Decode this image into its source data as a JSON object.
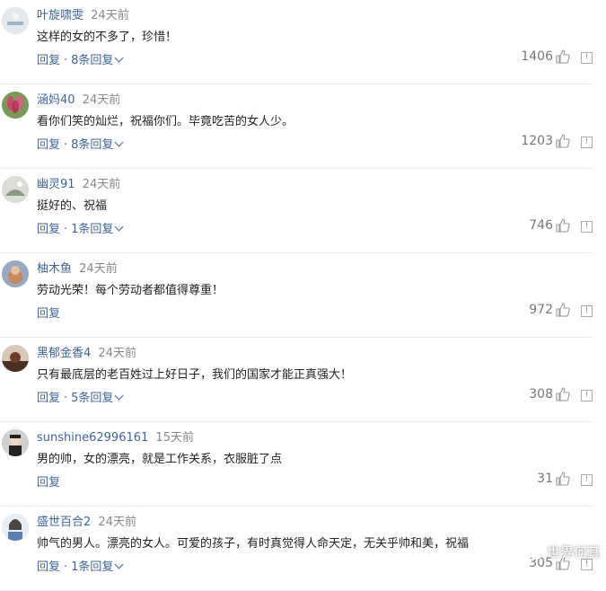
{
  "actions": {
    "reply_label": "回复"
  },
  "comments": [
    {
      "author": "叶旋啸雯",
      "time": "24天前",
      "text": "这样的女的不多了，珍惜！",
      "replies_label": "8条回复",
      "likes": "1406",
      "avatar_color": "#dfe5ea"
    },
    {
      "author": "涵妈40",
      "time": "24天前",
      "text": "看你们笑的灿烂，祝福你们。毕竟吃苦的女人少。",
      "replies_label": "8条回复",
      "likes": "1203",
      "avatar_color": "#b95068"
    },
    {
      "author": "幽灵91",
      "time": "24天前",
      "text": "挺好的、祝福",
      "replies_label": "1条回复",
      "likes": "746",
      "avatar_color": "#c9cfc7"
    },
    {
      "author": "柚木鱼",
      "time": "24天前",
      "text": "劳动光荣！每个劳动者都值得尊重！",
      "replies_label": "",
      "likes": "972",
      "avatar_color": "#7c8aa6"
    },
    {
      "author": "黑郁金香4",
      "time": "24天前",
      "text": "只有最底层的老百姓过上好日子，我们的国家才能正真强大！",
      "replies_label": "5条回复",
      "likes": "308",
      "avatar_color": "#5a3a2c"
    },
    {
      "author": "sunshine62996161",
      "time": "15天前",
      "text": "男的帅，女的漂亮，就是工作关系，衣服脏了点",
      "replies_label": "",
      "likes": "31",
      "avatar_color": "#3b3b3b"
    },
    {
      "author": "盛世百合2",
      "time": "24天前",
      "text": "帅气的男人。漂亮的女人。可爱的孩子，有时真觉得人命天定，无关乎帅和美，祝福",
      "replies_label": "1条回复",
      "likes": "305",
      "avatar_color": "#6b86a8"
    }
  ],
  "watermark": "世界何其"
}
